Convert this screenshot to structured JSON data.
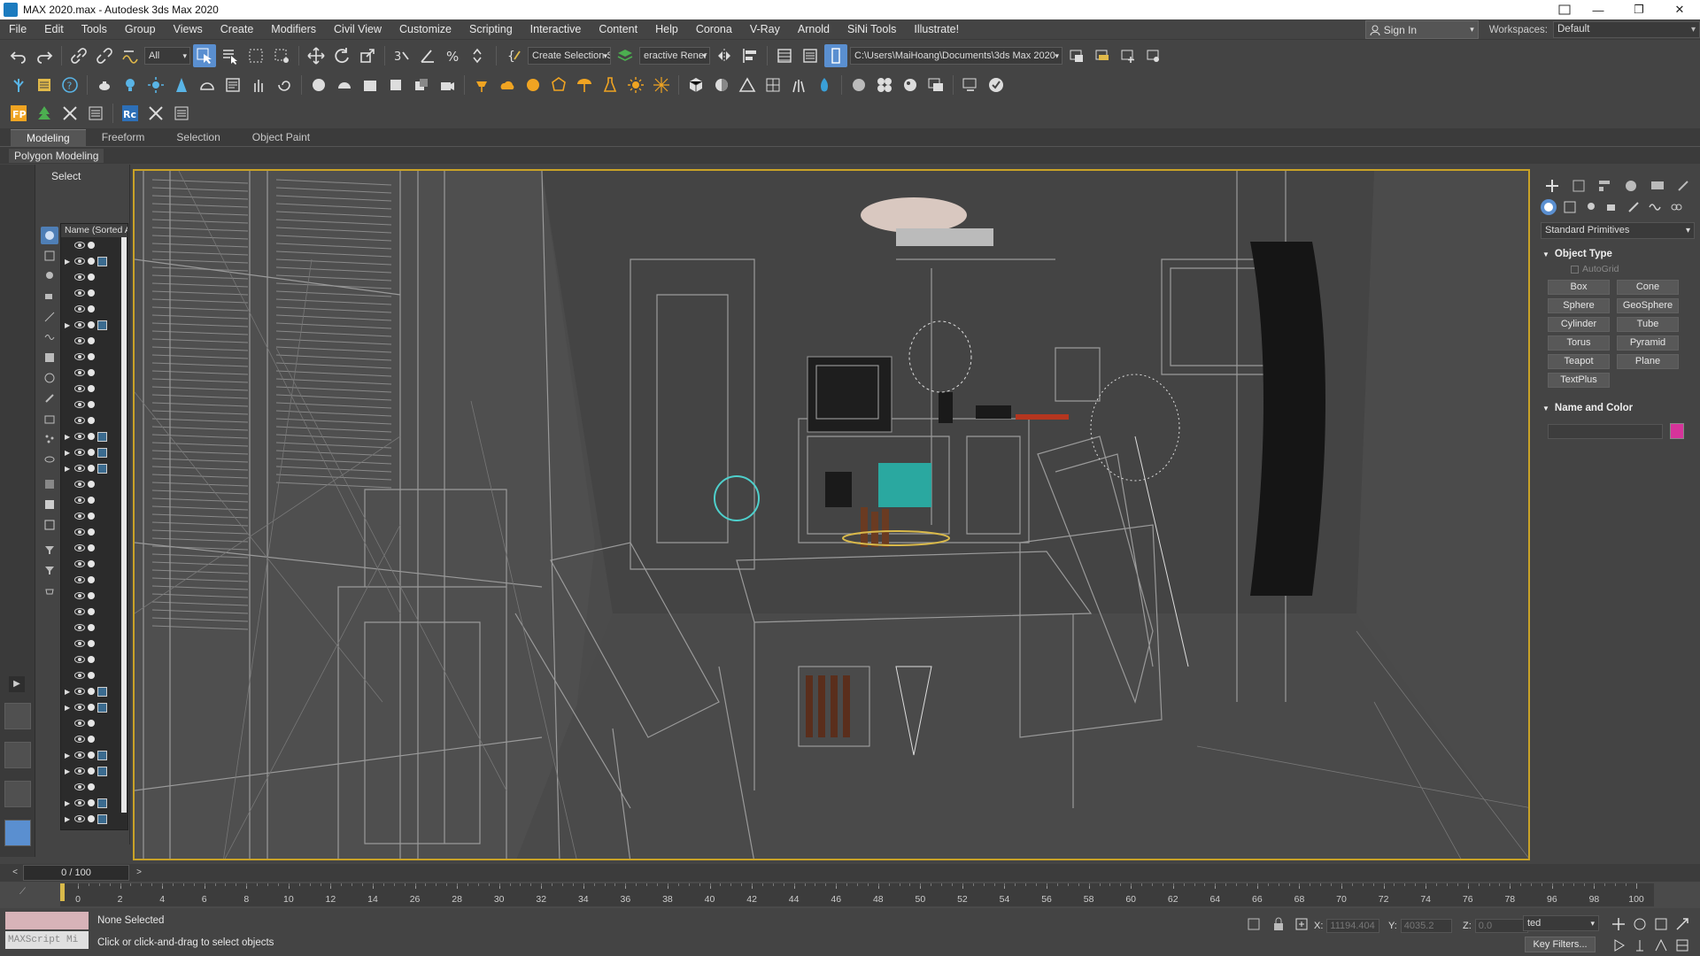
{
  "window": {
    "title": "MAX 2020.max - Autodesk 3ds Max 2020",
    "controls": [
      "—",
      "❐",
      "✕"
    ]
  },
  "menu": {
    "items": [
      "File",
      "Edit",
      "Tools",
      "Group",
      "Views",
      "Create",
      "Modifiers",
      "Civil View",
      "Customize",
      "Scripting",
      "Interactive",
      "Content",
      "Help",
      "Corona",
      "V-Ray",
      "Arnold",
      "SiNi Tools",
      "Illustrate!"
    ],
    "sign_in": "Sign In",
    "workspaces_label": "Workspaces:",
    "workspace_value": "Default"
  },
  "toolbar": {
    "selection_filter": "All",
    "named_selection": "Create Selection Se",
    "interactive_render": "eractive Rener",
    "project_path": "C:\\Users\\MaiHoang\\Documents\\3ds Max 2020"
  },
  "ribbon": {
    "tabs": [
      "Modeling",
      "Freeform",
      "Selection",
      "Object Paint"
    ],
    "active_tab": "Modeling",
    "panel": "Polygon Modeling"
  },
  "scene_explorer": {
    "header": "Select",
    "column": "Name (Sorted A"
  },
  "command_panel": {
    "category": "Standard Primitives",
    "object_type_title": "Object Type",
    "autogrid": "AutoGrid",
    "primitives": [
      "Box",
      "Cone",
      "Sphere",
      "GeoSphere",
      "Cylinder",
      "Tube",
      "Torus",
      "Pyramid",
      "Teapot",
      "Plane",
      "TextPlus"
    ],
    "name_color_title": "Name and Color",
    "object_color": "#d6339a"
  },
  "timeline": {
    "frame_display": "0 / 100",
    "prev": "<",
    "next": ">",
    "ruler_labels": [
      "0",
      "2",
      "4",
      "6",
      "8",
      "10",
      "12",
      "14",
      "26",
      "28",
      "30",
      "32",
      "34",
      "36",
      "38",
      "40",
      "42",
      "44",
      "46",
      "48",
      "50",
      "52",
      "54",
      "56",
      "58",
      "60",
      "62",
      "64",
      "66",
      "68",
      "70",
      "72",
      "74",
      "76",
      "78",
      "96",
      "98",
      "100"
    ]
  },
  "status": {
    "selection": "None Selected",
    "prompt": "Click or click-and-drag to select objects",
    "maxscript": "MAXScript Mi",
    "x_label": "X:",
    "x_value": "11194.404",
    "y_label": "Y:",
    "y_value": "4035.2",
    "z_label": "Z:",
    "z_value": "0.0",
    "key_mode": "ted",
    "key_filters": "Key Filters..."
  },
  "colors": {
    "viewport_border": "#c9a227",
    "active_button": "#5a8fd0"
  }
}
